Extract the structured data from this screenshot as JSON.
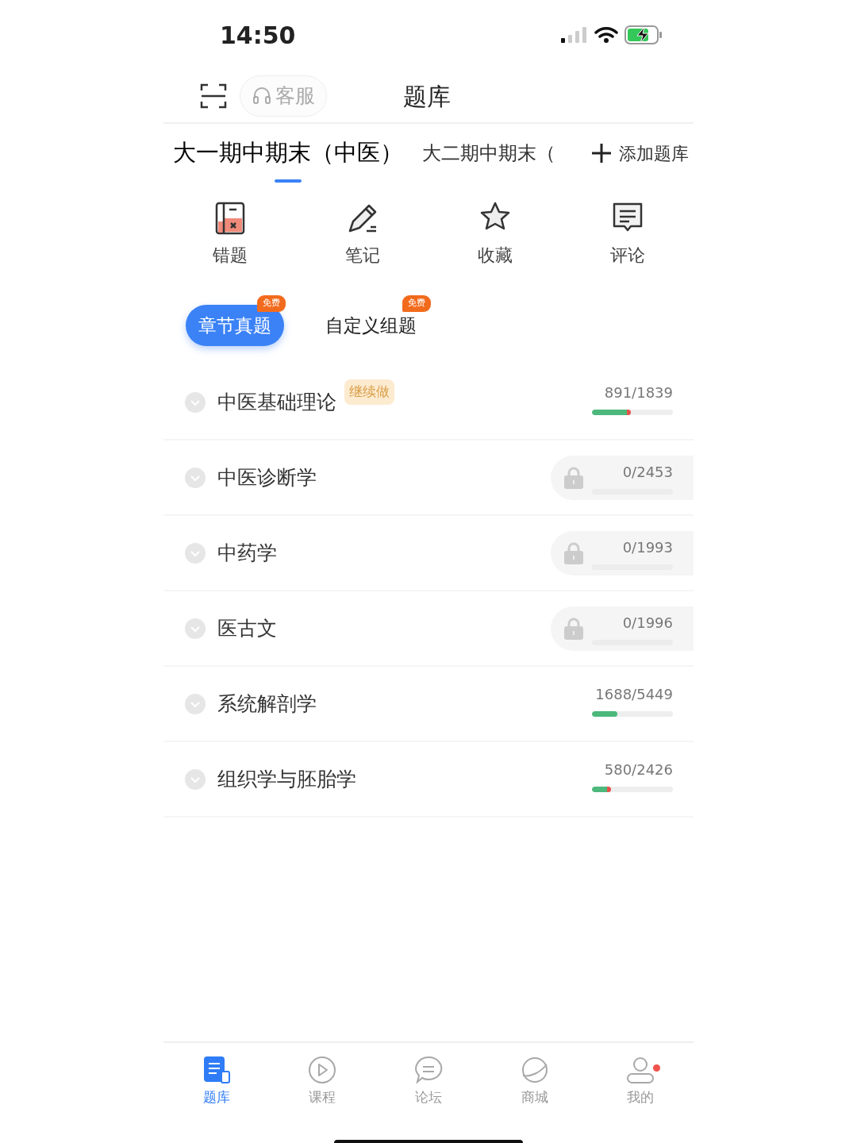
{
  "status_bar": {
    "time": "14:50"
  },
  "header": {
    "support_label": "客服",
    "title": "题库"
  },
  "bank_tabs": [
    {
      "label": "大一期中期末（中医）",
      "selected": true
    },
    {
      "label": "大二期中期末（",
      "selected": false
    }
  ],
  "add_bank": {
    "label": "添加题库"
  },
  "tools": [
    {
      "kind": "wrong",
      "label": "错题"
    },
    {
      "kind": "notes",
      "label": "笔记"
    },
    {
      "kind": "favorites",
      "label": "收藏"
    },
    {
      "kind": "comments",
      "label": "评论"
    }
  ],
  "modes": [
    {
      "label": "章节真题",
      "badge": "免费",
      "selected": true
    },
    {
      "label": "自定义组题",
      "badge": "免费",
      "selected": false
    }
  ],
  "chapters": [
    {
      "name": "中医基础理论",
      "tag": "继续做",
      "progress": "891/1839",
      "level": 0.48,
      "has_errors": true,
      "locked": false
    },
    {
      "name": "中医诊断学",
      "progress": "0/2453",
      "locked": true
    },
    {
      "name": "中药学",
      "progress": "0/1993",
      "locked": true
    },
    {
      "name": "医古文",
      "progress": "0/1996",
      "locked": true
    },
    {
      "name": "系统解剖学",
      "progress": "1688/5449",
      "level": 0.31,
      "has_errors": false,
      "locked": false
    },
    {
      "name": "组织学与胚胎学",
      "progress": "580/2426",
      "level": 0.24,
      "has_errors": true,
      "locked": false
    }
  ],
  "bottom_nav": [
    {
      "kind": "bank",
      "label": "题库",
      "selected": true,
      "dot": false
    },
    {
      "kind": "course",
      "label": "课程",
      "selected": false,
      "dot": false
    },
    {
      "kind": "forum",
      "label": "论坛",
      "selected": false,
      "dot": false
    },
    {
      "kind": "shop",
      "label": "商城",
      "selected": false,
      "dot": false
    },
    {
      "kind": "me",
      "label": "我的",
      "selected": false,
      "dot": true
    }
  ]
}
